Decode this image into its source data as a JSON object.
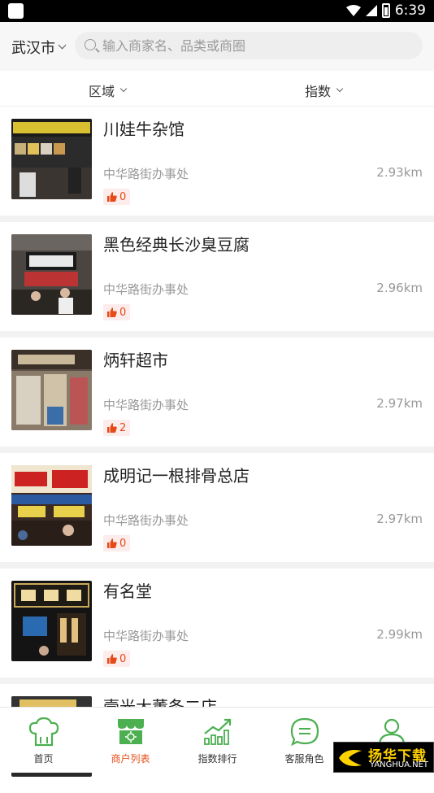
{
  "status_bar": {
    "time": "6:39"
  },
  "header": {
    "city": "武汉市",
    "search_placeholder": "输入商家名、品类或商圈"
  },
  "filters": [
    {
      "label": "区域"
    },
    {
      "label": "指数"
    }
  ],
  "merchants": [
    {
      "name": "川娃牛杂馆",
      "district": "中华路街办事处",
      "distance": "2.93km",
      "likes": "0"
    },
    {
      "name": "黑色经典长沙臭豆腐",
      "district": "中华路街办事处",
      "distance": "2.96km",
      "likes": "0"
    },
    {
      "name": "炳轩超市",
      "district": "中华路街办事处",
      "distance": "2.97km",
      "likes": "2"
    },
    {
      "name": "成明记一根排骨总店",
      "district": "中华路街办事处",
      "distance": "2.97km",
      "likes": "0"
    },
    {
      "name": "有名堂",
      "district": "中华路街办事处",
      "distance": "2.99km",
      "likes": "0"
    },
    {
      "name": "壹光大董条二店",
      "district": "",
      "distance": "",
      "likes": ""
    }
  ],
  "tabbar": [
    {
      "label": "首页",
      "icon": "chef-hat-icon"
    },
    {
      "label": "商户列表",
      "icon": "storefront-icon",
      "active": true
    },
    {
      "label": "指数排行",
      "icon": "bar-chart-icon"
    },
    {
      "label": "客服角色",
      "icon": "chat-bubble-icon"
    },
    {
      "label": "",
      "icon": "user-icon"
    }
  ],
  "watermark": {
    "cn": "扬华下载",
    "en": "YANGHUA.NET"
  },
  "colors": {
    "accent": "#e54d1a",
    "icon_green": "#4caf50"
  }
}
